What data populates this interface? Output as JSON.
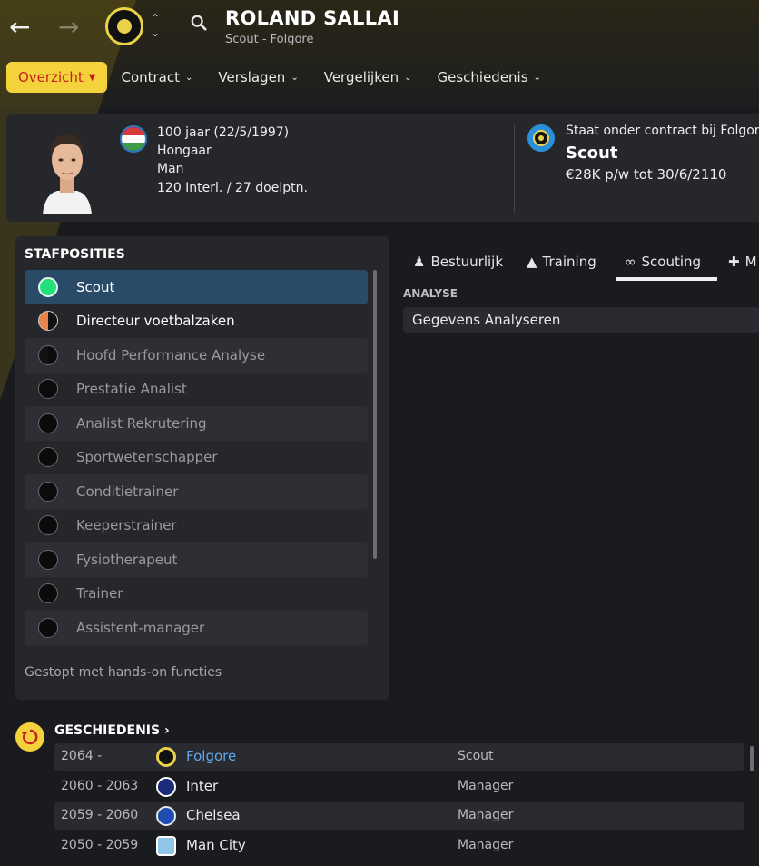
{
  "header": {
    "player_name": "ROLAND SALLAI",
    "player_subtitle": "Scout - Folgore"
  },
  "tabs": [
    {
      "label": "Overzicht",
      "active": true
    },
    {
      "label": "Contract"
    },
    {
      "label": "Verslagen"
    },
    {
      "label": "Vergelijken"
    },
    {
      "label": "Geschiedenis"
    }
  ],
  "profile": {
    "age_line": "100 jaar (22/5/1997)",
    "nationality": "Hongaar",
    "gender": "Man",
    "caps_line": "120 Interl. / 27 doelptn.",
    "contract_line": "Staat onder contract bij Folgore",
    "contract_role": "Scout",
    "contract_wage": "€28K p/w tot 30/6/2110"
  },
  "staff_positions": {
    "title": "STAFPOSITIES",
    "roles": [
      {
        "label": "Scout",
        "state": "selected"
      },
      {
        "label": "Directeur voetbalzaken",
        "state": "partial"
      },
      {
        "label": "Hoofd Performance Analyse",
        "state": "half"
      },
      {
        "label": "Prestatie Analist",
        "state": "half"
      },
      {
        "label": "Analist Rekrutering",
        "state": "half"
      },
      {
        "label": "Sportwetenschapper",
        "state": "half"
      },
      {
        "label": "Conditietrainer",
        "state": "half"
      },
      {
        "label": "Keeperstrainer",
        "state": "half"
      },
      {
        "label": "Fysiotherapeut",
        "state": "half"
      },
      {
        "label": "Trainer",
        "state": "half"
      },
      {
        "label": "Assistent-manager",
        "state": "half"
      }
    ],
    "footer": "Gestopt met hands-on functies"
  },
  "right_tabs": {
    "items": [
      "Bestuurlijk",
      "Training",
      "Scouting",
      "M"
    ],
    "active": "Scouting"
  },
  "analysis": {
    "section_title": "ANALYSE",
    "row_label": "Gegevens Analyseren"
  },
  "history": {
    "title": "GESCHIEDENIS",
    "rows": [
      {
        "years": "2064 -",
        "club": "Folgore",
        "role": "Scout"
      },
      {
        "years": "2060 - 2063",
        "club": "Inter",
        "role": "Manager"
      },
      {
        "years": "2059 - 2060",
        "club": "Chelsea",
        "role": "Manager"
      },
      {
        "years": "2050 - 2059",
        "club": "Man City",
        "role": "Manager"
      }
    ]
  },
  "colors": {
    "accent_yellow": "#f3d23c",
    "selected_row": "#2a4b68",
    "link_blue": "#5ea8ec",
    "status_green": "#2ecc71",
    "status_orange": "#e8834a"
  }
}
